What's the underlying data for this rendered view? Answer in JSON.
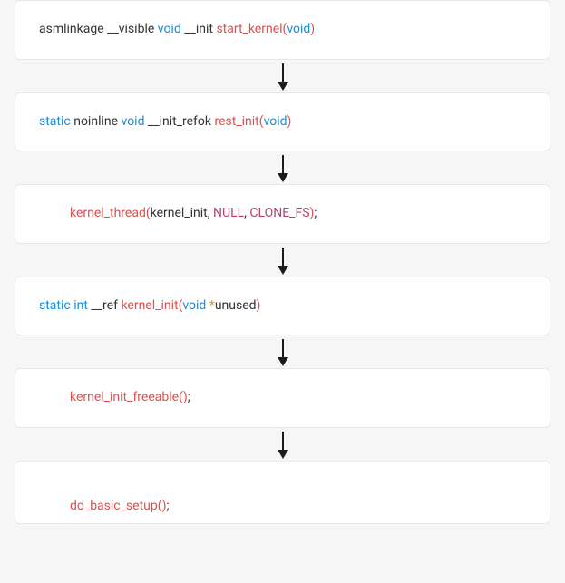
{
  "boxes": [
    {
      "tokens": [
        {
          "text": "asmlinkage ",
          "class": "tok-dark"
        },
        {
          "text": "__visible ",
          "class": "tok-dark"
        },
        {
          "text": "void ",
          "class": "tok-keyword"
        },
        {
          "text": "__init ",
          "class": "tok-dark"
        },
        {
          "text": "start_kernel",
          "class": "tok-func"
        },
        {
          "text": "(",
          "class": "tok-funcparen"
        },
        {
          "text": "void",
          "class": "tok-keyword"
        },
        {
          "text": ")",
          "class": "tok-funcparen"
        }
      ],
      "indent": "indent0"
    },
    {
      "tokens": [
        {
          "text": "static ",
          "class": "tok-keyword"
        },
        {
          "text": "noinline ",
          "class": "tok-dark"
        },
        {
          "text": "void ",
          "class": "tok-keyword"
        },
        {
          "text": "__init_refok ",
          "class": "tok-dark"
        },
        {
          "text": "rest_init",
          "class": "tok-func"
        },
        {
          "text": "(",
          "class": "tok-funcparen"
        },
        {
          "text": "void",
          "class": "tok-keyword"
        },
        {
          "text": ")",
          "class": "tok-funcparen"
        }
      ],
      "indent": "indent0"
    },
    {
      "tokens": [
        {
          "text": "kernel_thread",
          "class": "tok-func"
        },
        {
          "text": "(",
          "class": "tok-funcparen"
        },
        {
          "text": "kernel_init",
          "class": "tok-dark"
        },
        {
          "text": ", ",
          "class": "tok-dark"
        },
        {
          "text": "NULL",
          "class": "tok-arg"
        },
        {
          "text": ", ",
          "class": "tok-dark"
        },
        {
          "text": "CLONE_FS",
          "class": "tok-arg"
        },
        {
          "text": ")",
          "class": "tok-funcparen"
        },
        {
          "text": ";",
          "class": "tok-dark"
        }
      ],
      "indent": "indent"
    },
    {
      "tokens": [
        {
          "text": "static ",
          "class": "tok-keyword"
        },
        {
          "text": "int ",
          "class": "tok-keyword"
        },
        {
          "text": "__ref ",
          "class": "tok-dark"
        },
        {
          "text": "kernel_init",
          "class": "tok-func"
        },
        {
          "text": "(",
          "class": "tok-funcparen"
        },
        {
          "text": "void ",
          "class": "tok-keyword"
        },
        {
          "text": "*",
          "class": "tok-star"
        },
        {
          "text": "unused",
          "class": "tok-dark"
        },
        {
          "text": ")",
          "class": "tok-funcparen"
        }
      ],
      "indent": "indent0"
    },
    {
      "tokens": [
        {
          "text": "kernel_init_freeable",
          "class": "tok-func"
        },
        {
          "text": "(",
          "class": "tok-funcparen"
        },
        {
          "text": ")",
          "class": "tok-funcparen"
        },
        {
          "text": ";",
          "class": "tok-dark"
        }
      ],
      "indent": "indent"
    },
    {
      "tokens": [
        {
          "text": "do_basic_setup",
          "class": "tok-func"
        },
        {
          "text": "(",
          "class": "tok-funcparen"
        },
        {
          "text": ")",
          "class": "tok-funcparen"
        },
        {
          "text": ";",
          "class": "tok-dark"
        }
      ],
      "indent": "indent",
      "last": true
    }
  ]
}
